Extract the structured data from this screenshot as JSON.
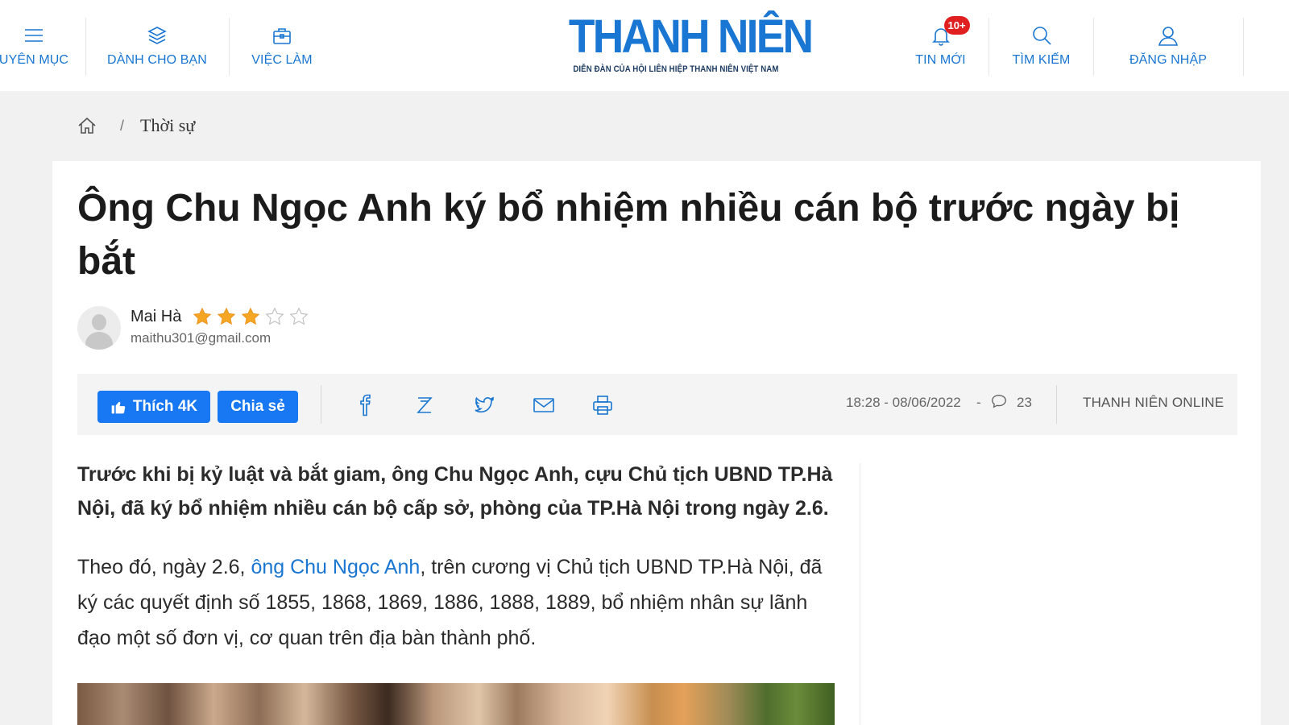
{
  "header": {
    "nav_left": [
      {
        "label": "UYÊN MỤC",
        "icon": "menu-icon"
      },
      {
        "label": "DÀNH CHO BẠN",
        "icon": "layers-icon"
      },
      {
        "label": "VIỆC LÀM",
        "icon": "briefcase-icon"
      }
    ],
    "logo": {
      "main": "THANH NIÊN",
      "tagline": "DIỄN ĐÀN CỦA HỘI LIÊN HIỆP THANH NIÊN VIỆT NAM"
    },
    "nav_right": [
      {
        "label": "TIN MỚI",
        "icon": "bell-icon",
        "badge": "10+"
      },
      {
        "label": "TÌM KIẾM",
        "icon": "search-icon"
      },
      {
        "label": "ĐĂNG NHẬP",
        "icon": "user-icon"
      }
    ]
  },
  "breadcrumb": {
    "home_icon": "home-icon",
    "separator": "/",
    "category": "Thời sự"
  },
  "article": {
    "title": "Ông Chu Ngọc Anh ký bổ nhiệm nhiều cán bộ trước ngày bị bắt",
    "author": {
      "name": "Mai Hà",
      "email": "maithu301@gmail.com",
      "rating": 3,
      "rating_max": 5
    },
    "toolbar": {
      "like_label": "Thích 4K",
      "share_label": "Chia sẻ",
      "share_icons": [
        "facebook-icon",
        "zalo-icon",
        "twitter-icon",
        "mail-icon",
        "print-icon"
      ],
      "datetime": "18:28 - 08/06/2022",
      "dash": "-",
      "comment_count": "23",
      "source": "THANH NIÊN ONLINE"
    },
    "sapo": "Trước khi bị kỷ luật và bắt giam, ông Chu Ngọc Anh, cựu Chủ tịch UBND TP.Hà Nội, đã ký bổ nhiệm nhiều cán bộ cấp sở, phòng của TP.Hà Nội trong ngày 2.6.",
    "paragraph": {
      "before_link": "Theo đó, ngày 2.6, ",
      "link_text": "ông Chu Ngọc Anh",
      "after_link": ", trên cương vị Chủ tịch UBND TP.Hà Nội, đã ký các quyết định số 1855, 1868, 1869, 1886, 1888, 1889, bổ nhiệm nhân sự lãnh đạo một số đơn vị, cơ quan trên địa bàn thành phố."
    }
  },
  "colors": {
    "brand": "#1976d2",
    "like_button": "#1877f2",
    "badge": "#e02020",
    "star": "#f5a623"
  }
}
